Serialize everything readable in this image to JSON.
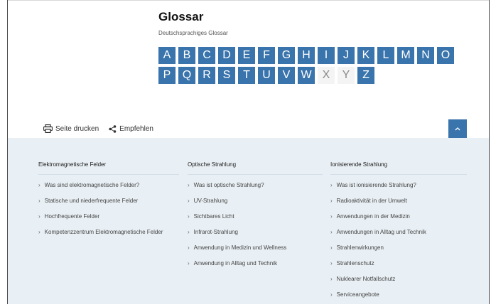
{
  "page": {
    "title": "Glossar",
    "subtitle": "Deutschsprachiges Glossar"
  },
  "alphabet": {
    "row1": [
      {
        "letter": "A",
        "enabled": true
      },
      {
        "letter": "B",
        "enabled": true
      },
      {
        "letter": "C",
        "enabled": true
      },
      {
        "letter": "D",
        "enabled": true
      },
      {
        "letter": "E",
        "enabled": true
      },
      {
        "letter": "F",
        "enabled": true
      },
      {
        "letter": "G",
        "enabled": true
      },
      {
        "letter": "H",
        "enabled": true
      },
      {
        "letter": "I",
        "enabled": true
      },
      {
        "letter": "J",
        "enabled": true
      },
      {
        "letter": "K",
        "enabled": true
      },
      {
        "letter": "L",
        "enabled": true
      },
      {
        "letter": "M",
        "enabled": true
      },
      {
        "letter": "N",
        "enabled": true
      },
      {
        "letter": "O",
        "enabled": true
      }
    ],
    "row2": [
      {
        "letter": "P",
        "enabled": true
      },
      {
        "letter": "Q",
        "enabled": true
      },
      {
        "letter": "R",
        "enabled": true
      },
      {
        "letter": "S",
        "enabled": true
      },
      {
        "letter": "T",
        "enabled": true
      },
      {
        "letter": "U",
        "enabled": true
      },
      {
        "letter": "V",
        "enabled": true
      },
      {
        "letter": "W",
        "enabled": true
      },
      {
        "letter": "X",
        "enabled": false
      },
      {
        "letter": "Y",
        "enabled": false
      },
      {
        "letter": "Z",
        "enabled": true
      }
    ]
  },
  "tools": {
    "print_label": "Seite drucken",
    "share_label": "Empfehlen",
    "print_icon": "printer-icon",
    "share_icon": "share-icon",
    "top_icon": "chevron-up-icon"
  },
  "colors": {
    "accent": "#3a74ac",
    "footer_bg": "#e9f0f5",
    "disabled_bg": "#f4f4f4"
  },
  "footer": {
    "columns": [
      {
        "heading": "Elektromagnetische Felder",
        "links": [
          "Was sind elektromagnetische Felder?",
          "Statische und niederfrequente Felder",
          "Hochfrequente Felder",
          "Kompetenzzentrum Elektromagnetische Felder"
        ]
      },
      {
        "heading": "Optische Strahlung",
        "links": [
          "Was ist optische Strahlung?",
          "UV-Strahlung",
          "Sichtbares Licht",
          "Infrarot-Strahlung",
          "Anwendung in Medizin und Wellness",
          "Anwendung in Alltag und Technik"
        ]
      },
      {
        "heading": "Ionisierende Strahlung",
        "links": [
          "Was ist ionisierende Strahlung?",
          "Radioaktivität in der Umwelt",
          "Anwendungen in der Medizin",
          "Anwendungen in Alltag und Technik",
          "Strahlenwirkungen",
          "Strahlenschutz",
          "Nuklearer Notfallschutz",
          "Serviceangebote"
        ]
      }
    ]
  }
}
